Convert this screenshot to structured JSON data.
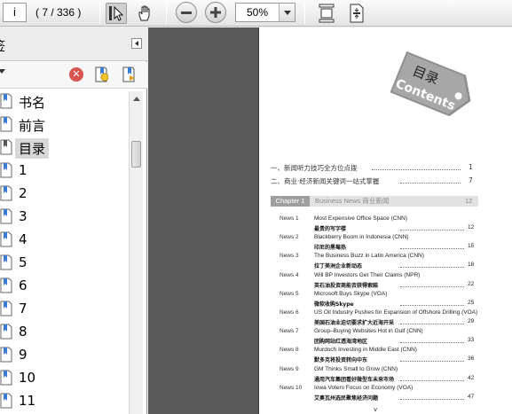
{
  "toolbar": {
    "page_input": "i",
    "page_count": "( 7 / 336 )",
    "zoom_value": "50%",
    "icons": [
      "select-tool-icon",
      "hand-tool-icon",
      "zoom-out-icon",
      "zoom-in-icon",
      "fit-page-icon",
      "fit-width-icon"
    ]
  },
  "sidebar": {
    "title": "签",
    "items": [
      {
        "label": "书名"
      },
      {
        "label": "前言"
      },
      {
        "label": "目录",
        "selected": true
      },
      {
        "label": "1"
      },
      {
        "label": "2"
      },
      {
        "label": "3"
      },
      {
        "label": "4"
      },
      {
        "label": "5"
      },
      {
        "label": "6"
      },
      {
        "label": "7"
      },
      {
        "label": "8"
      },
      {
        "label": "9"
      },
      {
        "label": "10"
      },
      {
        "label": "11"
      }
    ]
  },
  "page": {
    "tag_title_cn": "目录",
    "tag_title_en": "Contents",
    "part1": {
      "text": "一、新闻听力技巧全方位点拨",
      "page": "1"
    },
    "part2": {
      "text": "二、商业·经济新闻关键词一站式掌握",
      "page": "7"
    },
    "chapter": {
      "tag": "Chapter 1",
      "title": "Business News 商业新闻",
      "page": "12"
    },
    "news": [
      {
        "no": "News 1",
        "en": "Most Expensive Office Space (CNN)",
        "cn": "最贵的写字楼",
        "page": "12"
      },
      {
        "no": "News 2",
        "en": "Blackberry Boom in Indonesia (CNN)",
        "cn": "印尼的黑莓热",
        "page": "15"
      },
      {
        "no": "News 3",
        "en": "The Business Buzz in Latin America (CNN)",
        "cn": "拉丁美洲企业新动态",
        "page": "18"
      },
      {
        "no": "News 4",
        "en": "Will BP Investors Get Their Claims (NPR)",
        "cn": "英石油投资商能否获得索赔",
        "page": "22"
      },
      {
        "no": "News 5",
        "en": "Microsoft Buys Skype (VOA)",
        "cn": "微软收购Skype",
        "page": "25"
      },
      {
        "no": "News 6",
        "en": "US Oil Industry Pushes for Expansion of Offshore Drilling (VOA)",
        "cn": "美国石油业迫切要求扩大近海开采",
        "page": "29"
      },
      {
        "no": "News 7",
        "en": "Group–Buying Websites Hot in Gulf (CNN)",
        "cn": "团购网站红透海湾地区",
        "page": "33"
      },
      {
        "no": "News 8",
        "en": "Murdoch Investing in Middle East (CNN)",
        "cn": "默多克将投资转向中东",
        "page": "36"
      },
      {
        "no": "News 9",
        "en": "GM Thinks Small to Grow (CNN)",
        "cn": "通用汽车集团看好微型车未来市场",
        "page": "42"
      },
      {
        "no": "News 10",
        "en": "Iowa Voters Focus on Economy (VOA)",
        "cn": "艾奥瓦州选民聚焦经济问题",
        "page": "47"
      }
    ],
    "footer": "v"
  }
}
